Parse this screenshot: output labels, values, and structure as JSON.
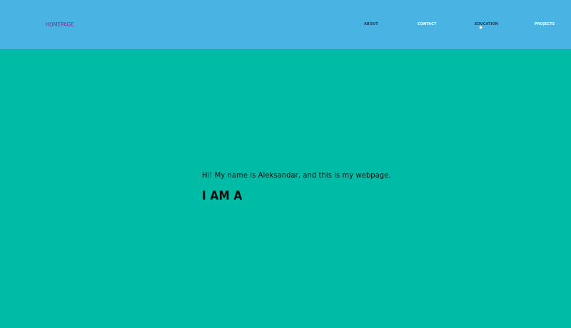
{
  "header": {
    "brand": "HOMEPAGE",
    "nav": {
      "about": "ABOUT",
      "contact": "CONTACT",
      "education": "EDUCATION",
      "projects": "PROJECTS"
    }
  },
  "hero": {
    "greeting": "Hi! My name is Aleksandar, and this is my webpage.",
    "headline": "I AM A"
  },
  "colors": {
    "nav_background": "#49b4e4",
    "page_background": "#00bba6",
    "brand_text": "#7d2b8f",
    "dark_nav_text": "#1d3b56",
    "light_nav_text": "#ffffff",
    "body_text": "#111111"
  }
}
